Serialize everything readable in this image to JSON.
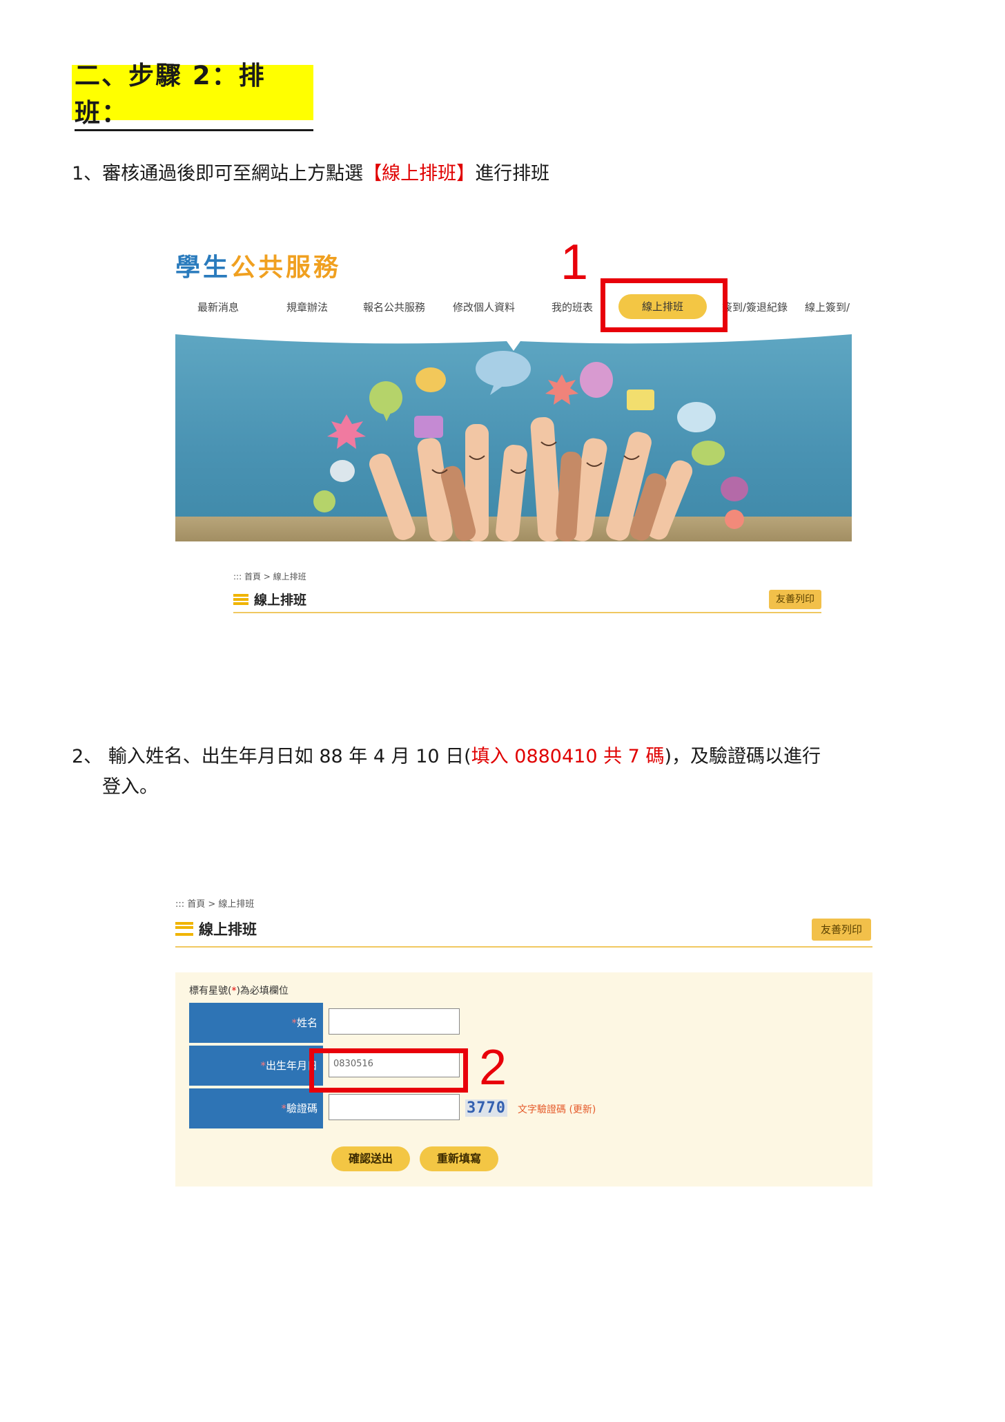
{
  "heading": {
    "text": "二、步驟 2：排班："
  },
  "step1": {
    "prefix": "1、審核通過後即可至網站上方點選",
    "highlight": "【線上排班】",
    "suffix": "進行排班"
  },
  "screenshot1": {
    "logo_part1": "學生",
    "logo_part2": "公共服務",
    "nav": [
      "最新消息",
      "規章辦法",
      "報名公共服務",
      "修改個人資料",
      "我的班表",
      "線上排班",
      "簽到/簽退紀錄",
      "線上簽到/"
    ],
    "active_nav": "線上排班",
    "annotation_number": "1",
    "breadcrumb": "::: 首頁 > 線上排班",
    "page_title": "線上排班",
    "print_label": "友善列印"
  },
  "step2": {
    "prefix": "2、  輸入姓名、出生年月日如 88 年 4 月 10 日(",
    "highlight": "填入 0880410 共 7 碼",
    "suffix": ")，及驗證碼以進行",
    "line2": "登入。"
  },
  "screenshot2": {
    "breadcrumb": "::: 首頁 > 線上排班",
    "page_title": "線上排班",
    "print_label": "友善列印",
    "required_note_pre": "標有星號(",
    "required_note_star": "*",
    "required_note_post": ")為必填欄位",
    "fields": [
      {
        "label": "姓名",
        "value": ""
      },
      {
        "label": "出生年月日",
        "value": "0830516"
      },
      {
        "label": "驗證碼",
        "value": ""
      }
    ],
    "captcha_code": "3770",
    "captcha_link": "文字驗證碼 (更新)",
    "submit_label": "確認送出",
    "reset_label": "重新填寫",
    "annotation_number": "2"
  },
  "colors": {
    "annotation": "#e8000a",
    "nav_active": "#f3c644",
    "form_label_bg": "#2e74b5",
    "highlight_yellow": "#ffff00"
  }
}
